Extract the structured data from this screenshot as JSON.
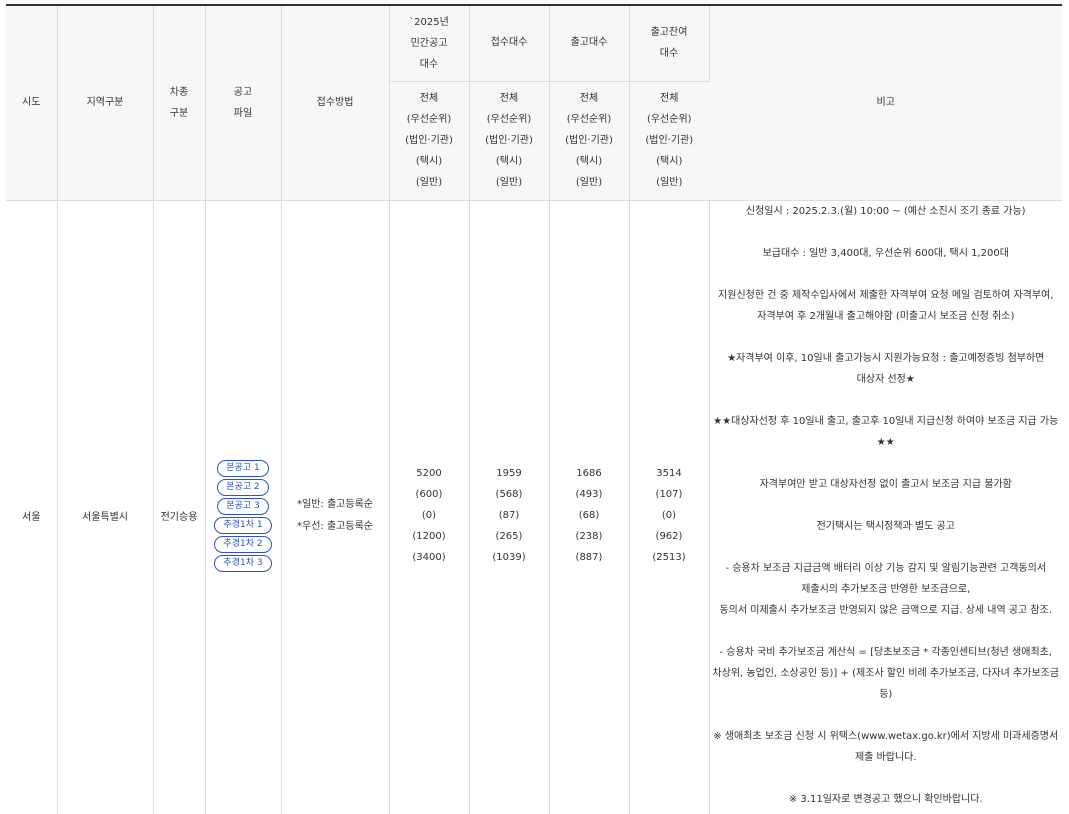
{
  "headers": {
    "sido": "시도",
    "region": "지역구분",
    "vehicle_type": [
      "차종",
      "구분"
    ],
    "notice_file": [
      "공고",
      "파일"
    ],
    "method": "접수방법",
    "notice_count": [
      "`2025년",
      "민간공고",
      "대수"
    ],
    "received": "접수대수",
    "released": "출고대수",
    "remaining": [
      "출고잔여",
      "대수"
    ],
    "remark": "비고",
    "sub_rows": [
      "전체",
      "(우선순위)",
      "(법인·기관)",
      "(택시)",
      "(일반)"
    ]
  },
  "row": {
    "sido": "서울",
    "region": "서울특별시",
    "vehicle_type": "전기승용",
    "files": [
      "본공고 1",
      "본공고 2",
      "본공고 3",
      "추경1차 1",
      "추경1차 2",
      "추경1차 3"
    ],
    "method": [
      "*일반: 출고등록순",
      "*우선: 출고등록순"
    ],
    "notice_count": [
      "5200",
      "(600)",
      "(0)",
      "(1200)",
      "(3400)"
    ],
    "received": [
      "1959",
      "(568)",
      "(87)",
      "(265)",
      "(1039)"
    ],
    "released": [
      "1686",
      "(493)",
      "(68)",
      "(238)",
      "(887)"
    ],
    "remaining": [
      "3514",
      "(107)",
      "(0)",
      "(962)",
      "(2513)"
    ],
    "remarks": [
      [
        "신청일시 : 2025.2.3.(월) 10:00 ~ (예산 소진시 조기 종료 가능)"
      ],
      [
        "보급대수 : 일반 3,400대, 우선순위 600대, 택시 1,200대"
      ],
      [
        "지원신청한 건 중 제작수입사에서 제출한 자격부여 요청 메일 검토하여 자격부여,",
        "자격부여 후 2개월내 출고해야함 (미출고시 보조금 신청 취소)"
      ],
      [
        "★자격부여 이후, 10일내 출고가능시 지원가능요청 : 출고예정증빙 첨부하면",
        "대상자 선정★"
      ],
      [
        "★★대상자선정 후 10일내 출고, 출고후 10일내 지급신청 하여야 보조금 지급 가능",
        "★★"
      ],
      [
        "자격부여만 받고 대상자선정 없이 출고시 보조금 지급 불가함"
      ],
      [
        "전기택시는 택시정책과 별도 공고"
      ],
      [
        "- 승용차 보조금 지급금액 배터리 이상 기능 감지 및 알림기능관련 고객동의서",
        "제출시의 추가보조금 반영한 보조금으로,",
        "동의서 미제출시 추가보조금 반영되지 않은 금액으로 지급. 상세 내역 공고 참조."
      ],
      [
        "- 승용차 국비 추가보조금 계산식 = [당초보조금 * 각종인센티브(청년 생애최초,",
        "차상위, 농업인, 소상공인 등)] + (제조사 할인 비례 추가보조금, 다자녀 추가보조금",
        "등)"
      ],
      [
        "※ 생애최초 보조금 신청 시 위택스(www.wetax.go.kr)에서 지방세 미과세증명서",
        "제출 바랍니다."
      ],
      [
        "※ 3.11일자로 변경공고 했으니 확인바랍니다."
      ]
    ]
  },
  "colors": {
    "button_border": "#2b57b8",
    "header_bg": "#f7f7f7",
    "border": "#dcdcdc"
  }
}
